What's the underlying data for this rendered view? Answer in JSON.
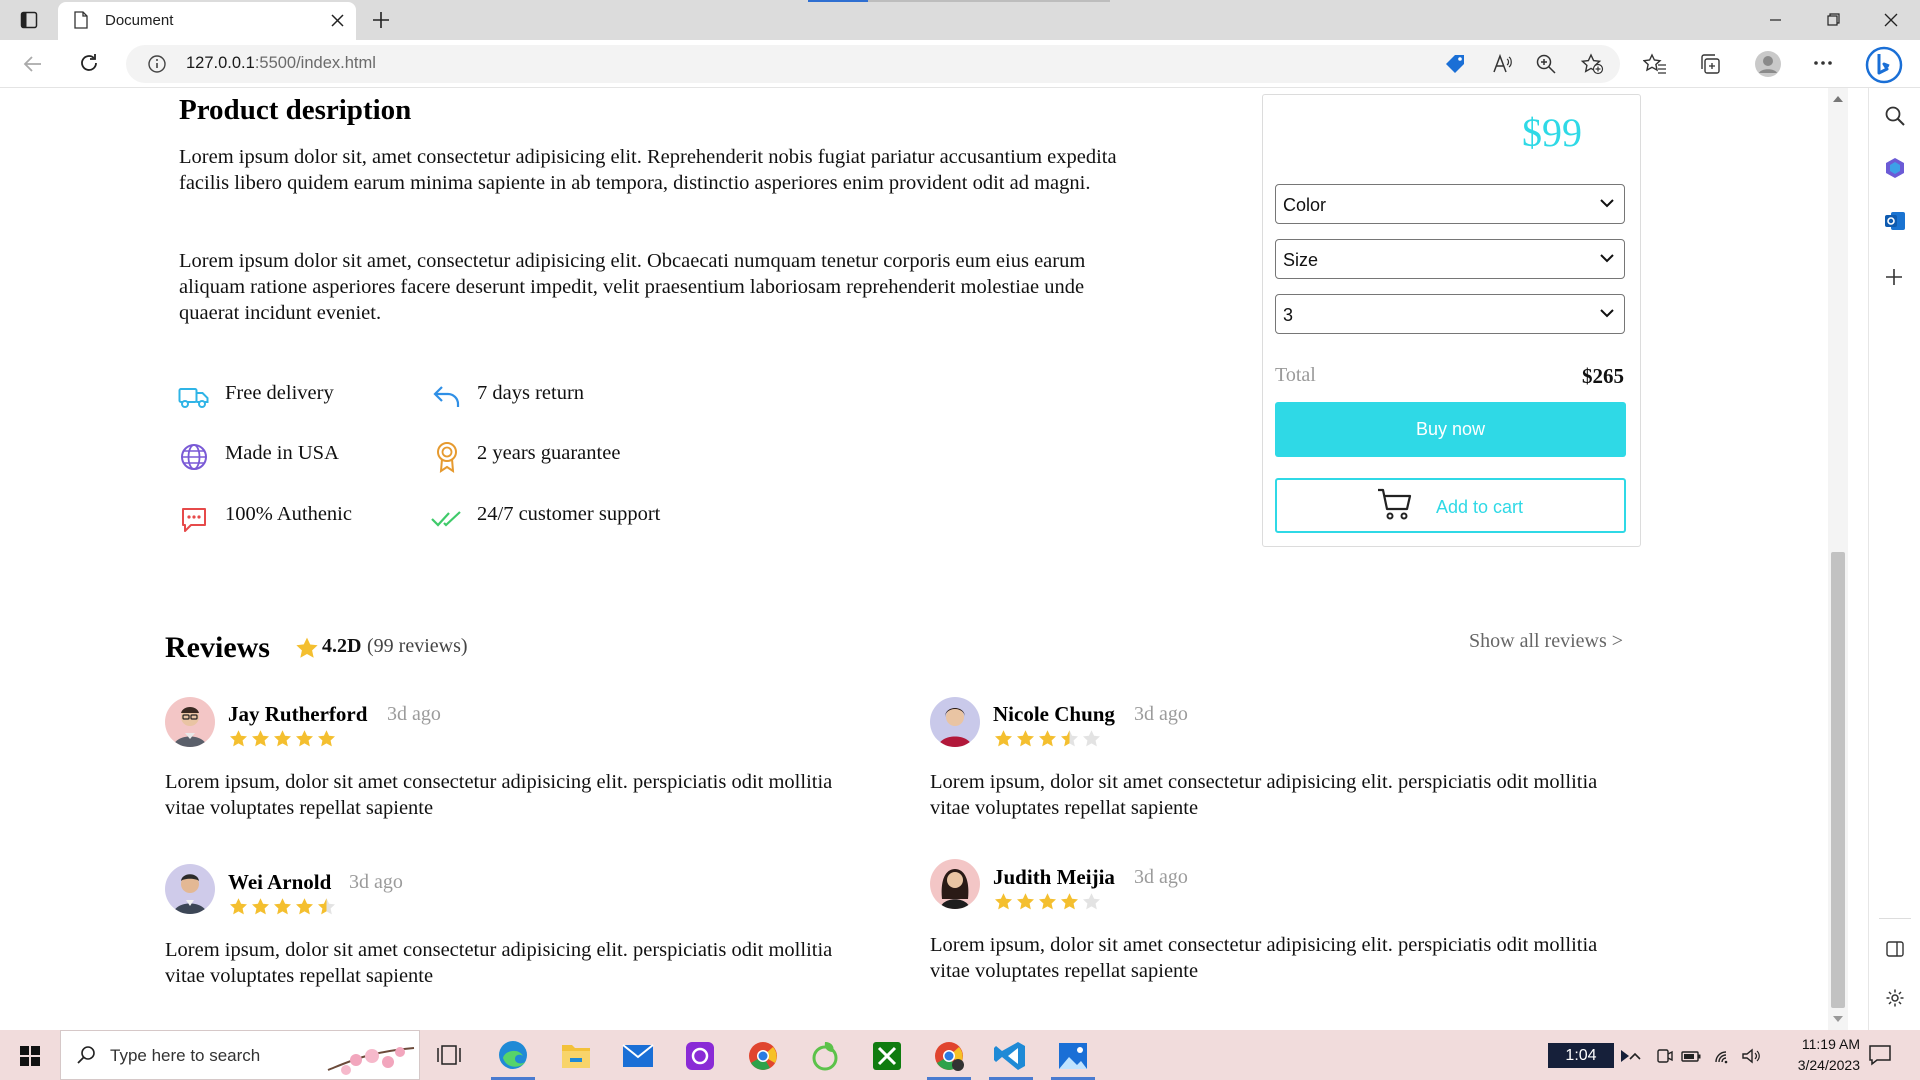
{
  "browser": {
    "tab_title": "Document",
    "url_host": "127.0.0.1",
    "url_rest": ":5500/index.html"
  },
  "product": {
    "title": "Product desription",
    "paragraphs": [
      "Lorem ipsum dolor sit, amet consectetur adipisicing elit. Reprehenderit nobis fugiat pariatur accusantium expedita facilis libero quidem earum minima sapiente in ab tempora, distinctio asperiores enim provident odit ad magni.",
      "Lorem ipsum dolor sit amet, consectetur adipisicing elit. Obcaecati numquam tenetur corporis eum eius earum aliquam ratione asperiores facere deserunt impedit, velit praesentium laboriosam reprehenderit molestiae unde quaerat incidunt eveniet."
    ],
    "features": [
      {
        "label": "Free delivery",
        "icon": "truck-icon",
        "color": "#2fb4e6"
      },
      {
        "label": "7 days return",
        "icon": "return-arrow-icon",
        "color": "#2f8fe6"
      },
      {
        "label": "Made in USA",
        "icon": "globe-icon",
        "color": "#7a5ad6"
      },
      {
        "label": "2 years guarantee",
        "icon": "award-icon",
        "color": "#e69a2f"
      },
      {
        "label": "100% Authenic",
        "icon": "chat-icon",
        "color": "#e64a4a"
      },
      {
        "label": "24/7 customer support",
        "icon": "double-check-icon",
        "color": "#3fca6a"
      }
    ]
  },
  "buybox": {
    "price": "$99",
    "color_select": "Color",
    "size_select": "Size",
    "qty_select": "3",
    "total_label": "Total",
    "total_value": "$265",
    "buy_label": "Buy now",
    "cart_label": "Add to cart",
    "accent": "#2fd9e6"
  },
  "reviews": {
    "title": "Reviews",
    "score": "4.2D",
    "count": "(99 reviews)",
    "show_all": "Show all reviews >",
    "items": [
      {
        "name": "Jay Rutherford",
        "time": "3d ago",
        "rating": 5,
        "text": "Lorem ipsum, dolor sit amet consectetur adipisicing elit. perspiciatis odit mollitia vitae voluptates repellat sapiente"
      },
      {
        "name": "Nicole Chung",
        "time": "3d ago",
        "rating": 3.5,
        "text": "Lorem ipsum, dolor sit amet consectetur adipisicing elit. perspiciatis odit mollitia vitae voluptates repellat sapiente"
      },
      {
        "name": "Wei Arnold",
        "time": "3d ago",
        "rating": 4.5,
        "text": "Lorem ipsum, dolor sit amet consectetur adipisicing elit. perspiciatis odit mollitia vitae voluptates repellat sapiente"
      },
      {
        "name": "Judith Meijia",
        "time": "3d ago",
        "rating": 4,
        "text": "Lorem ipsum, dolor sit amet consectetur adipisicing elit. perspiciatis odit mollitia vitae voluptates repellat sapiente"
      }
    ]
  },
  "taskbar": {
    "search_placeholder": "Type here to search",
    "timer": "1:04",
    "time": "11:19 AM",
    "date": "3/24/2023",
    "apps": [
      "task-view-icon",
      "edge-icon",
      "file-explorer-icon",
      "mail-icon",
      "photo-app-icon",
      "chrome-icon",
      "leaf-app-icon",
      "xbox-icon",
      "chrome-profile-icon",
      "vscode-icon",
      "photos-icon"
    ]
  }
}
